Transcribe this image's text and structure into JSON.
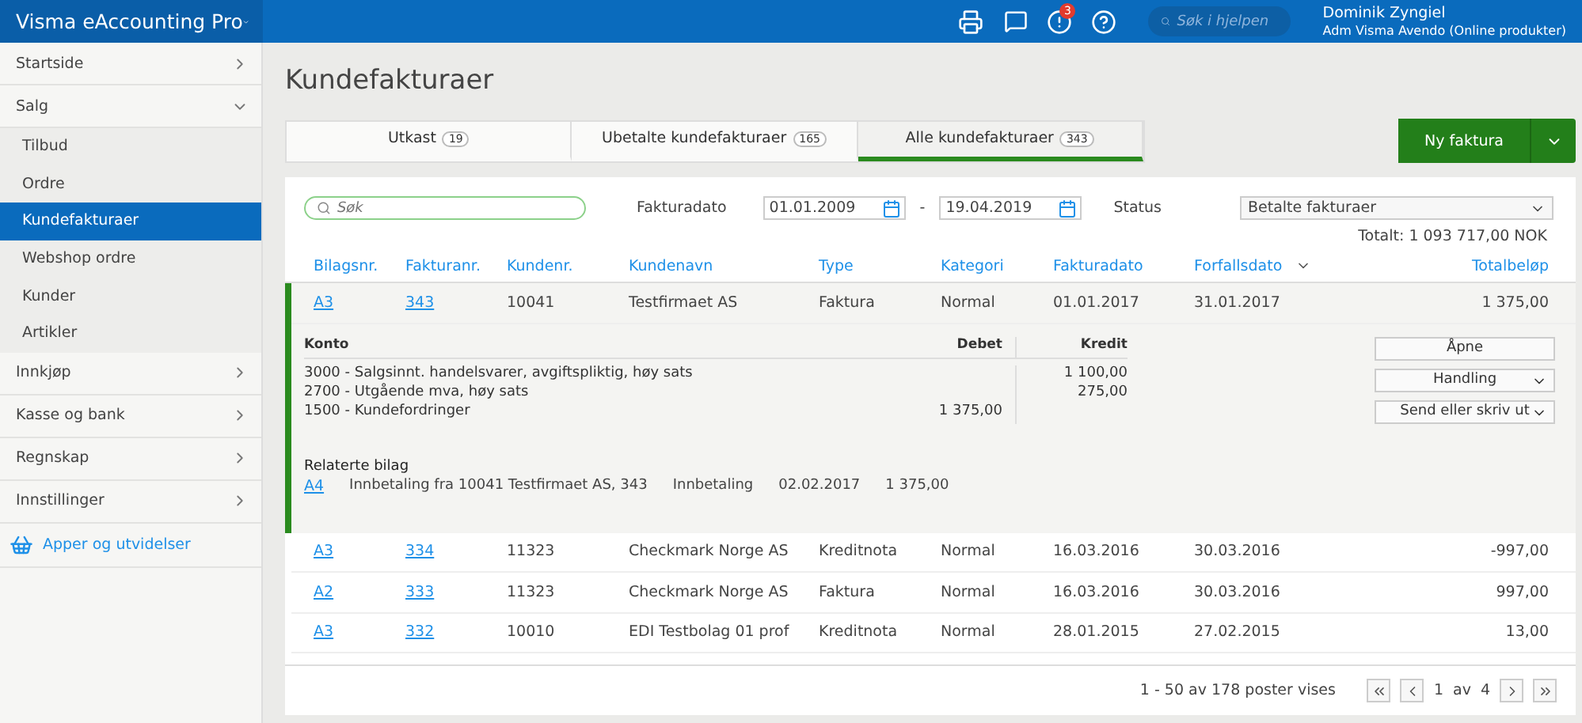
{
  "app": {
    "title": "Visma eAccounting Pro",
    "notifications": "3",
    "help_search": {
      "placeholder": "Søk i hjelpen"
    },
    "user": {
      "name": "Dominik Zyngiel",
      "company": "Adm Visma Avendo (Online produkter)"
    }
  },
  "sidebar": {
    "sections": [
      {
        "label": "Startside",
        "expanded": false
      },
      {
        "label": "Salg",
        "expanded": true,
        "children": [
          {
            "label": "Tilbud",
            "selected": false
          },
          {
            "label": "Ordre",
            "selected": false
          },
          {
            "label": "Kundefakturaer",
            "selected": true
          },
          {
            "label": "Webshop ordre",
            "selected": false
          },
          {
            "label": "Kunder",
            "selected": false
          },
          {
            "label": "Artikler",
            "selected": false
          }
        ]
      },
      {
        "label": "Innkjøp",
        "expanded": false
      },
      {
        "label": "Kasse og bank",
        "expanded": false
      },
      {
        "label": "Regnskap",
        "expanded": false
      },
      {
        "label": "Innstillinger",
        "expanded": false
      }
    ],
    "apps_link": "Apper og utvidelser"
  },
  "page": {
    "title": "Kundefakturaer",
    "tabs": [
      {
        "label": "Utkast",
        "count": "19",
        "selected": false
      },
      {
        "label": "Ubetalte kundefakturaer",
        "count": "165",
        "selected": false
      },
      {
        "label": "Alle kundefakturaer",
        "count": "343",
        "selected": true
      }
    ],
    "new_button": "Ny faktura",
    "filters": {
      "search": {
        "placeholder": "Søk"
      },
      "date_label": "Fakturadato",
      "date_from": "01.01.2009",
      "date_separator": "-",
      "date_to": "19.04.2019",
      "status_label": "Status",
      "status_value": "Betalte fakturaer"
    },
    "total": "Totalt: 1 093 717,00 NOK",
    "table": {
      "columns": [
        "Bilagsnr.",
        "Fakturanr.",
        "Kundenr.",
        "Kundenavn",
        "Type",
        "Kategori",
        "Fakturadato",
        "Forfallsdato",
        "Totalbeløp"
      ],
      "rows": [
        {
          "cells": [
            "A3",
            "343",
            "10041",
            "Testfirmaet AS",
            "Faktura",
            "Normal",
            "01.01.2017",
            "31.01.2017",
            "1 375,00"
          ],
          "expanded": true
        },
        {
          "cells": [
            "A3",
            "334",
            "11323",
            "Checkmark Norge AS",
            "Kreditnota",
            "Normal",
            "16.03.2016",
            "30.03.2016",
            "-997,00"
          ],
          "expanded": false
        },
        {
          "cells": [
            "A2",
            "333",
            "11323",
            "Checkmark Norge AS",
            "Faktura",
            "Normal",
            "16.03.2016",
            "30.03.2016",
            "997,00"
          ],
          "expanded": false
        },
        {
          "cells": [
            "A3",
            "332",
            "10010",
            "EDI Testbolag 01 prof",
            "Kreditnota",
            "Normal",
            "28.01.2015",
            "27.02.2015",
            "13,00"
          ],
          "expanded": false
        }
      ]
    },
    "detail": {
      "columns": [
        "Konto",
        "Debet",
        "Kredit"
      ],
      "lines": [
        {
          "account": "3000 - Salgsinnt. handelsvarer, avgiftspliktig, høy sats",
          "credit": "1 100,00"
        },
        {
          "account": "2700 - Utgående mva, høy sats",
          "credit": "275,00"
        },
        {
          "account": "1500 - Kundefordringer",
          "debit": "1 375,00"
        }
      ],
      "actions": [
        "Åpne",
        "Handling",
        "Send eller skriv ut"
      ],
      "related_title": "Relaterte bilag",
      "related": [
        [
          "A4",
          "Innbetaling fra 10041 Testfirmaet AS, 343",
          "Innbetaling",
          "02.02.2017",
          "1 375,00"
        ]
      ]
    },
    "pagination": {
      "summary": "1 - 50 av 178 poster vises",
      "page": "1",
      "of_label": "av",
      "pages": "4"
    }
  }
}
